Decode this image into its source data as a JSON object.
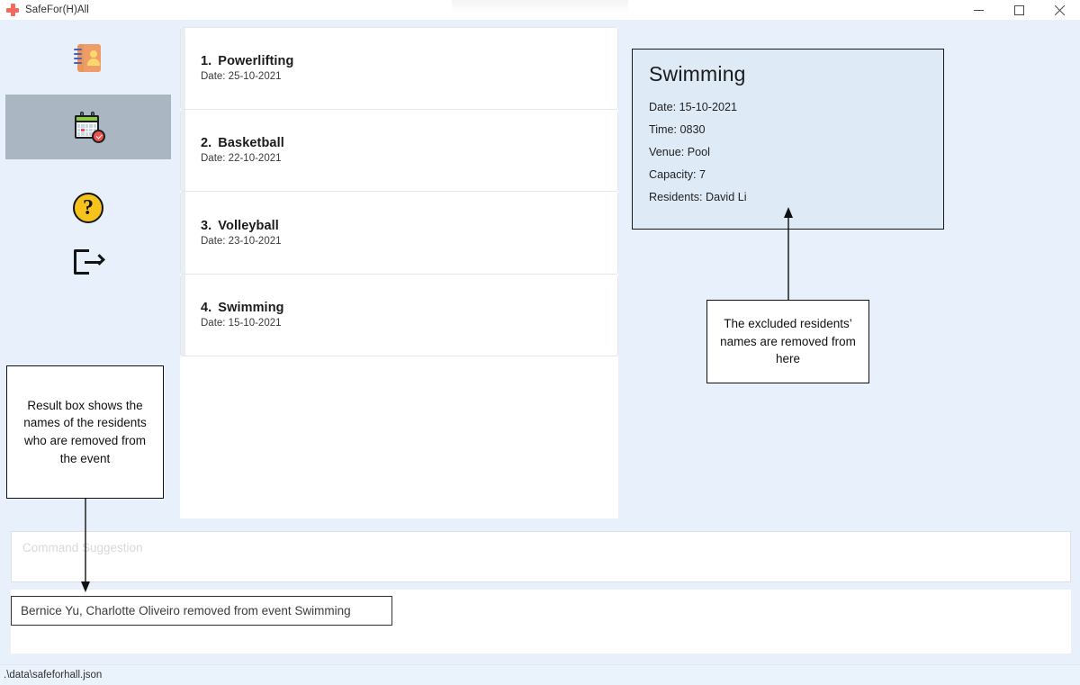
{
  "window": {
    "title": "SafeFor(H)All",
    "app_icon": "red-cross-icon",
    "minimize_label": "—",
    "maximize_label": "□",
    "close_label": "✕"
  },
  "sidebar": {
    "items": [
      {
        "icon": "address-book-icon",
        "name": "residents",
        "selected": false
      },
      {
        "icon": "calendar-check-icon",
        "name": "events",
        "selected": true
      },
      {
        "icon": "help-circle-icon",
        "name": "help",
        "selected": false
      },
      {
        "icon": "logout-icon",
        "name": "exit",
        "selected": false
      }
    ],
    "selected_background": "#aab6c2"
  },
  "event_list": {
    "items": [
      {
        "number": "1.",
        "name": "Powerlifting",
        "date": "Date: 25-10-2021"
      },
      {
        "number": "2.",
        "name": "Basketball",
        "date": "Date: 22-10-2021"
      },
      {
        "number": "3.",
        "name": "Volleyball",
        "date": "Date: 23-10-2021"
      },
      {
        "number": "4.",
        "name": "Swimming",
        "date": "Date: 15-10-2021"
      }
    ]
  },
  "detail": {
    "title": "Swimming",
    "date": "Date: 15-10-2021",
    "time": "Time: 0830",
    "venue": "Venue: Pool",
    "capacity": "Capacity: 7",
    "residents": "Residents: David Li"
  },
  "annotations": {
    "right": "The excluded residents’ names are removed from here",
    "left": "Result box shows the names of the residents who are removed from the event"
  },
  "command_suggestion": {
    "placeholder": "Command Suggestion",
    "value": ""
  },
  "result": {
    "message": "Bernice Yu, Charlotte Oliveiro removed from event Swimming"
  },
  "statusbar": {
    "path": ".\\data\\safeforhall.json"
  },
  "colors": {
    "window_background": "#e8f1fb",
    "panel_white": "#ffffff",
    "detail_background": "#dfeaf7",
    "accent_red": "#f4695f",
    "sidebar_selected": "#aab6c2"
  }
}
